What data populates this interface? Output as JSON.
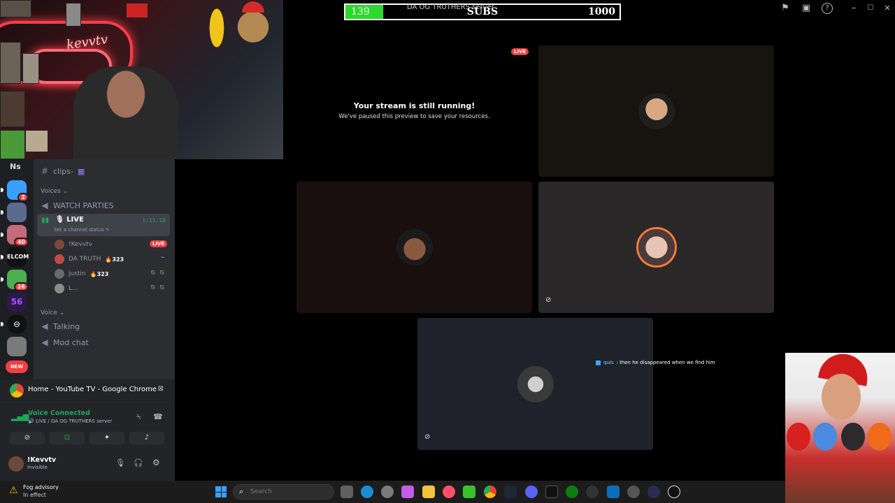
{
  "subs_widget": {
    "current": "139",
    "label": "SUBS",
    "goal": "1000",
    "progress_fraction": 0.139,
    "server_ticker": "DA OG TRUTHERS server",
    "fill_color": "#2bd92b"
  },
  "window_controls": {
    "icons": [
      "flag-icon",
      "inbox-icon",
      "help-icon",
      "minimize-icon",
      "maximize-icon",
      "close-icon"
    ],
    "glyphs": [
      "⚑",
      "▣",
      "?",
      "–",
      "☐",
      "✕"
    ]
  },
  "servers": {
    "top_label": "Ns",
    "badges": [
      "2",
      "",
      "40",
      "",
      "26",
      "",
      "",
      ""
    ],
    "new_label": "NEW",
    "fifty_six": "56",
    "elcom": "ELCOM"
  },
  "channels": {
    "clips": "clips-",
    "voices_category": "Voices",
    "watch_parties": "WATCH PARTIES",
    "live_channel": "LIVE",
    "live_timer": "1:11:10",
    "channel_status_placeholder": "Set a channel status",
    "users": [
      {
        "name": "!Kevvtv",
        "badge": "LIVE"
      },
      {
        "name": "DA TRUTH",
        "flame": "323"
      },
      {
        "name": "justin",
        "flame": "323"
      },
      {
        "name": "L..."
      }
    ],
    "voice_category": "Voice",
    "talking": "Talking",
    "mod_chat": "Mod chat"
  },
  "activity": {
    "title": "Home - YouTube TV - Google Chrome"
  },
  "voice_panel": {
    "status": "Voice Connected",
    "location": "LIVE / DA OG TRUTHERS server",
    "status_color": "#23a55a"
  },
  "user_panel": {
    "username": "!Kevvtv",
    "status": "Invisible"
  },
  "stage": {
    "live_badge": "LIVE",
    "paused_title": "Your stream is still running!",
    "paused_sub": "We've paused this preview to save your resources.",
    "chat_user": "quis",
    "chat_text": ": then he disappeared when we find him"
  },
  "taskbar": {
    "weather_title": "Fog advisory",
    "weather_sub": "In effect",
    "search_placeholder": "Search"
  }
}
